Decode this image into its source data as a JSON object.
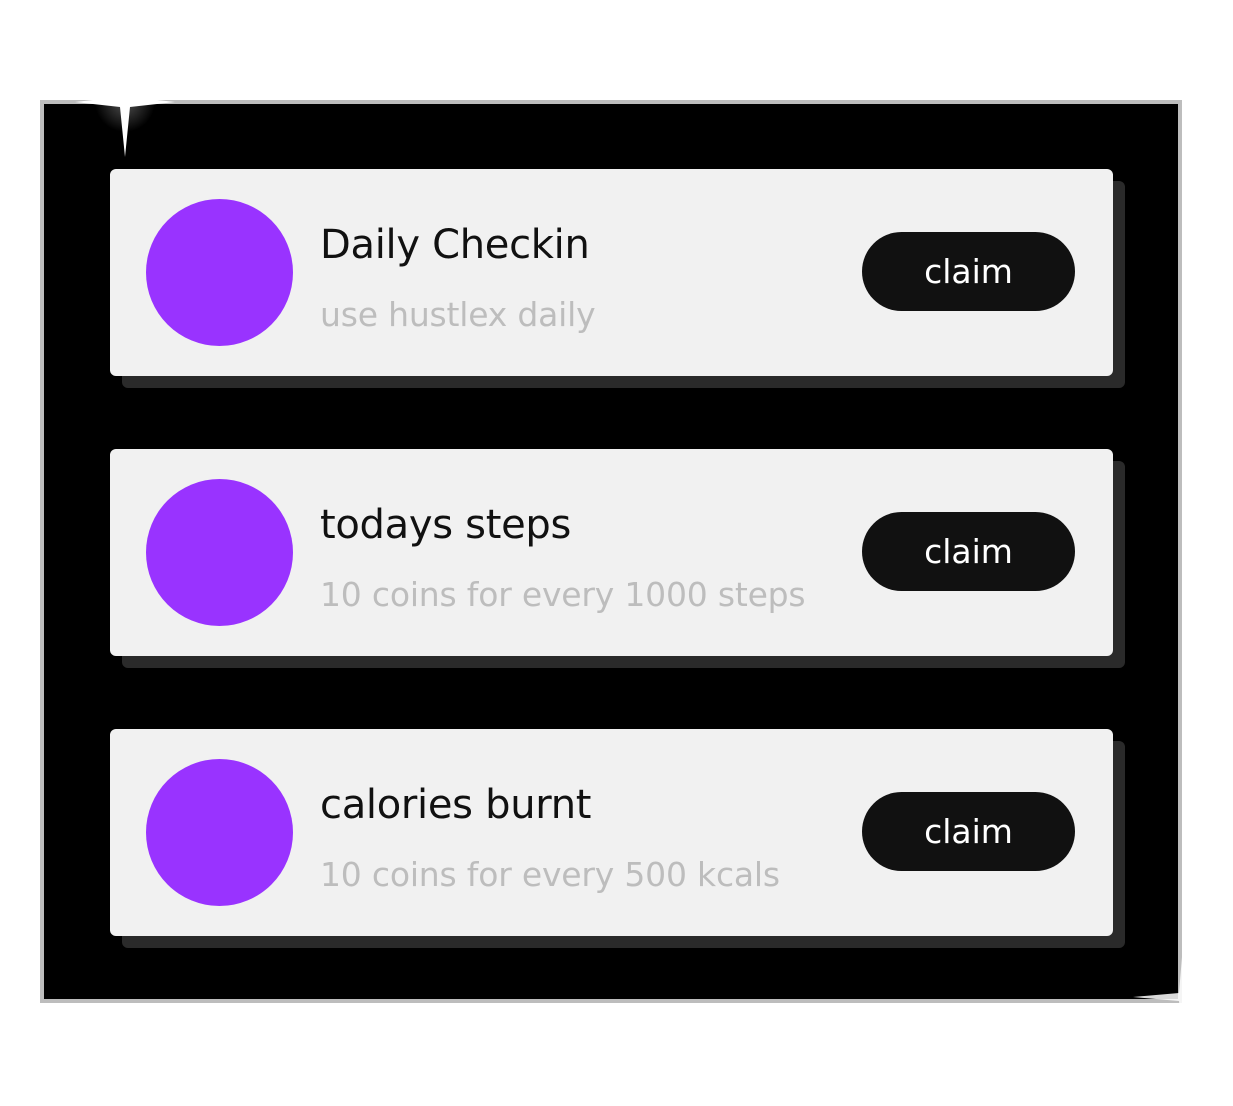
{
  "colors": {
    "frame_border": "#bdbdbd",
    "background": "#000000",
    "card": "#f1f1f1",
    "avatar": "#9933ff",
    "button": "#111111",
    "button_text": "#ffffff",
    "title_text": "#111111",
    "subtitle_text": "#bdbdbd"
  },
  "tasks": [
    {
      "title": "Daily Checkin",
      "subtitle": "use hustlex daily",
      "button_label": "claim"
    },
    {
      "title": "todays steps",
      "subtitle": "10 coins for every 1000 steps",
      "button_label": "claim"
    },
    {
      "title": "calories burnt",
      "subtitle": "10 coins for every 500 kcals",
      "button_label": "claim"
    }
  ]
}
